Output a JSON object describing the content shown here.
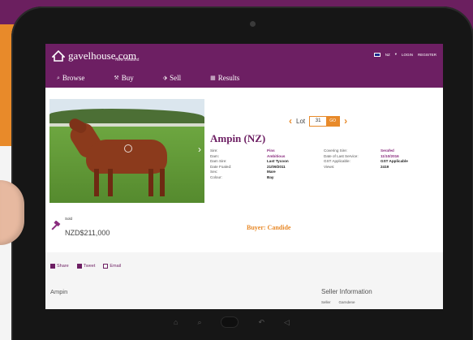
{
  "site": {
    "logo_text": "gavelhouse.com",
    "logo_sub": "New Zealand",
    "region": "NZ",
    "login": "LOGIN",
    "register": "REGISTER"
  },
  "nav": [
    {
      "label": "Browse",
      "icon": "magnifier-icon"
    },
    {
      "label": "Buy",
      "icon": "gavel-icon"
    },
    {
      "label": "Sell",
      "icon": "tag-icon"
    },
    {
      "label": "Results",
      "icon": "calendar-icon"
    }
  ],
  "lot": {
    "label": "Lot",
    "number": "31",
    "go": "GO"
  },
  "horse": {
    "name": "Ampin (NZ)"
  },
  "details": [
    {
      "label1": "Sire:",
      "value1": "Pins",
      "label2": "Covering Sire:",
      "value2": "Serafed"
    },
    {
      "label1": "Dam:",
      "value1": "Ambitious",
      "label2": "Date of Last Service:",
      "value2": "11/10/2016"
    },
    {
      "label1": "Dam Sire:",
      "value1": "Last Tycoon",
      "label2": "GST Applicable:",
      "value2": "GST Applicable"
    },
    {
      "label1": "Date Foaled:",
      "value1": "21/09/2011",
      "label2": "Views:",
      "value2": "2419"
    },
    {
      "label1": "Sex:",
      "value1": "Mare",
      "label2": "",
      "value2": ""
    },
    {
      "label1": "Colour:",
      "value1": "Bay",
      "label2": "",
      "value2": ""
    }
  ],
  "sale": {
    "status": "Sold",
    "price": "NZD$211,000",
    "buyer": "Buyer: Candide"
  },
  "share": {
    "share": "Share",
    "tweet": "Tweet",
    "email": "Email"
  },
  "sections": {
    "left": "Ampin",
    "right": "Seller Information",
    "seller_label": "Seller",
    "seller_value": "Garndene"
  },
  "colors": {
    "brand": "#6d1f63",
    "accent": "#e88a2a"
  }
}
